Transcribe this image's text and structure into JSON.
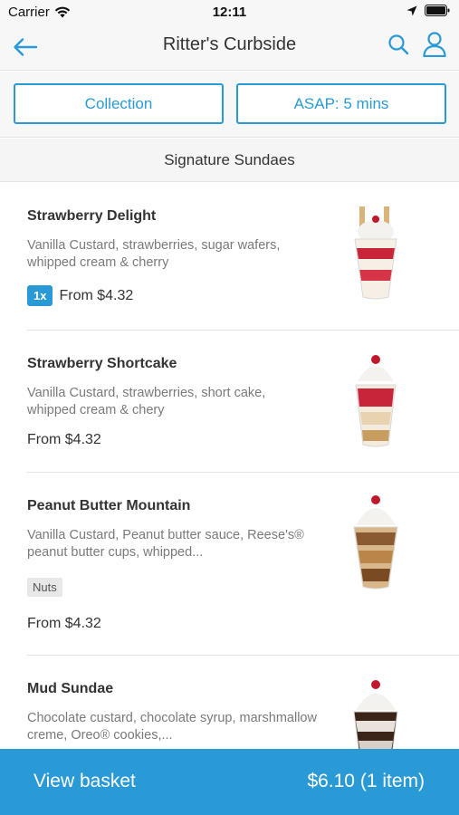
{
  "status_bar": {
    "carrier": "Carrier",
    "time": "12:11"
  },
  "nav": {
    "title": "Ritter's Curbside"
  },
  "options": {
    "collection": "Collection",
    "time": "ASAP: 5 mins"
  },
  "section": {
    "title": "Signature Sundaes"
  },
  "items": [
    {
      "name": "Strawberry Delight",
      "description": "Vanilla Custard, strawberries, sugar wafers, whipped cream & cherry",
      "quantity": "1x",
      "price": "From $4.32"
    },
    {
      "name": "Strawberry Shortcake",
      "description": "Vanilla Custard, strawberries, short cake, whipped cream & chery",
      "price": "From $4.32"
    },
    {
      "name": "Peanut Butter Mountain",
      "description": "Vanilla Custard, Peanut butter sauce, Reese's® peanut butter cups, whipped...",
      "tag": "Nuts",
      "price": "From $4.32"
    },
    {
      "name": "Mud Sundae",
      "description": "Chocolate custard, chocolate syrup, marshmallow creme, Oreo® cookies,..."
    }
  ],
  "basket": {
    "label": "View basket",
    "total": "$6.10 (1 item)"
  },
  "colors": {
    "accent": "#2a9ad6"
  }
}
